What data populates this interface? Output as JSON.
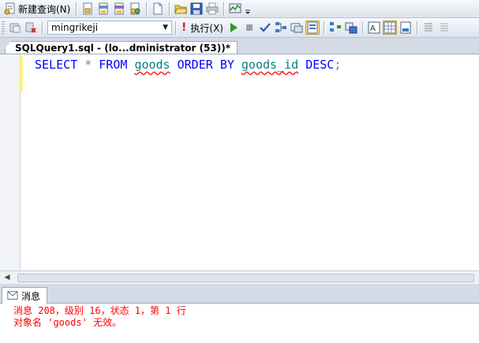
{
  "toolbar1": {
    "new_query_label": "新建查询(N)",
    "icons": [
      "new-query-icon",
      "database-engine-query-icon",
      "analysis-mdx-query-icon",
      "analysis-dmx-query-icon",
      "analysis-xmla-query-icon",
      "new-file-icon",
      "open-file-icon",
      "save-icon",
      "save-all-icon",
      "activity-monitor-icon"
    ]
  },
  "toolbar2": {
    "database_value": "mingrikeji",
    "execute_label": "执行(X)"
  },
  "document_tab": {
    "title": "SQLQuery1.sql - (lo...dministrator (53))*"
  },
  "editor": {
    "code_tokens": [
      {
        "text": "SELECT",
        "kind": "kw"
      },
      {
        "text": " ",
        "kind": "sp"
      },
      {
        "text": "*",
        "kind": "op"
      },
      {
        "text": " ",
        "kind": "sp"
      },
      {
        "text": "FROM",
        "kind": "kw"
      },
      {
        "text": " ",
        "kind": "sp"
      },
      {
        "text": "goods",
        "kind": "id"
      },
      {
        "text": " ",
        "kind": "sp"
      },
      {
        "text": "ORDER",
        "kind": "kw"
      },
      {
        "text": " ",
        "kind": "sp"
      },
      {
        "text": "BY",
        "kind": "kw"
      },
      {
        "text": " ",
        "kind": "sp"
      },
      {
        "text": "goods_id",
        "kind": "id"
      },
      {
        "text": " ",
        "kind": "sp"
      },
      {
        "text": "DESC",
        "kind": "kw"
      },
      {
        "text": ";",
        "kind": "op"
      }
    ]
  },
  "results": {
    "tab_label": "消息",
    "messages": [
      "消息 208，级别 16，状态 1，第 1 行",
      "对象名 'goods' 无效。"
    ]
  }
}
